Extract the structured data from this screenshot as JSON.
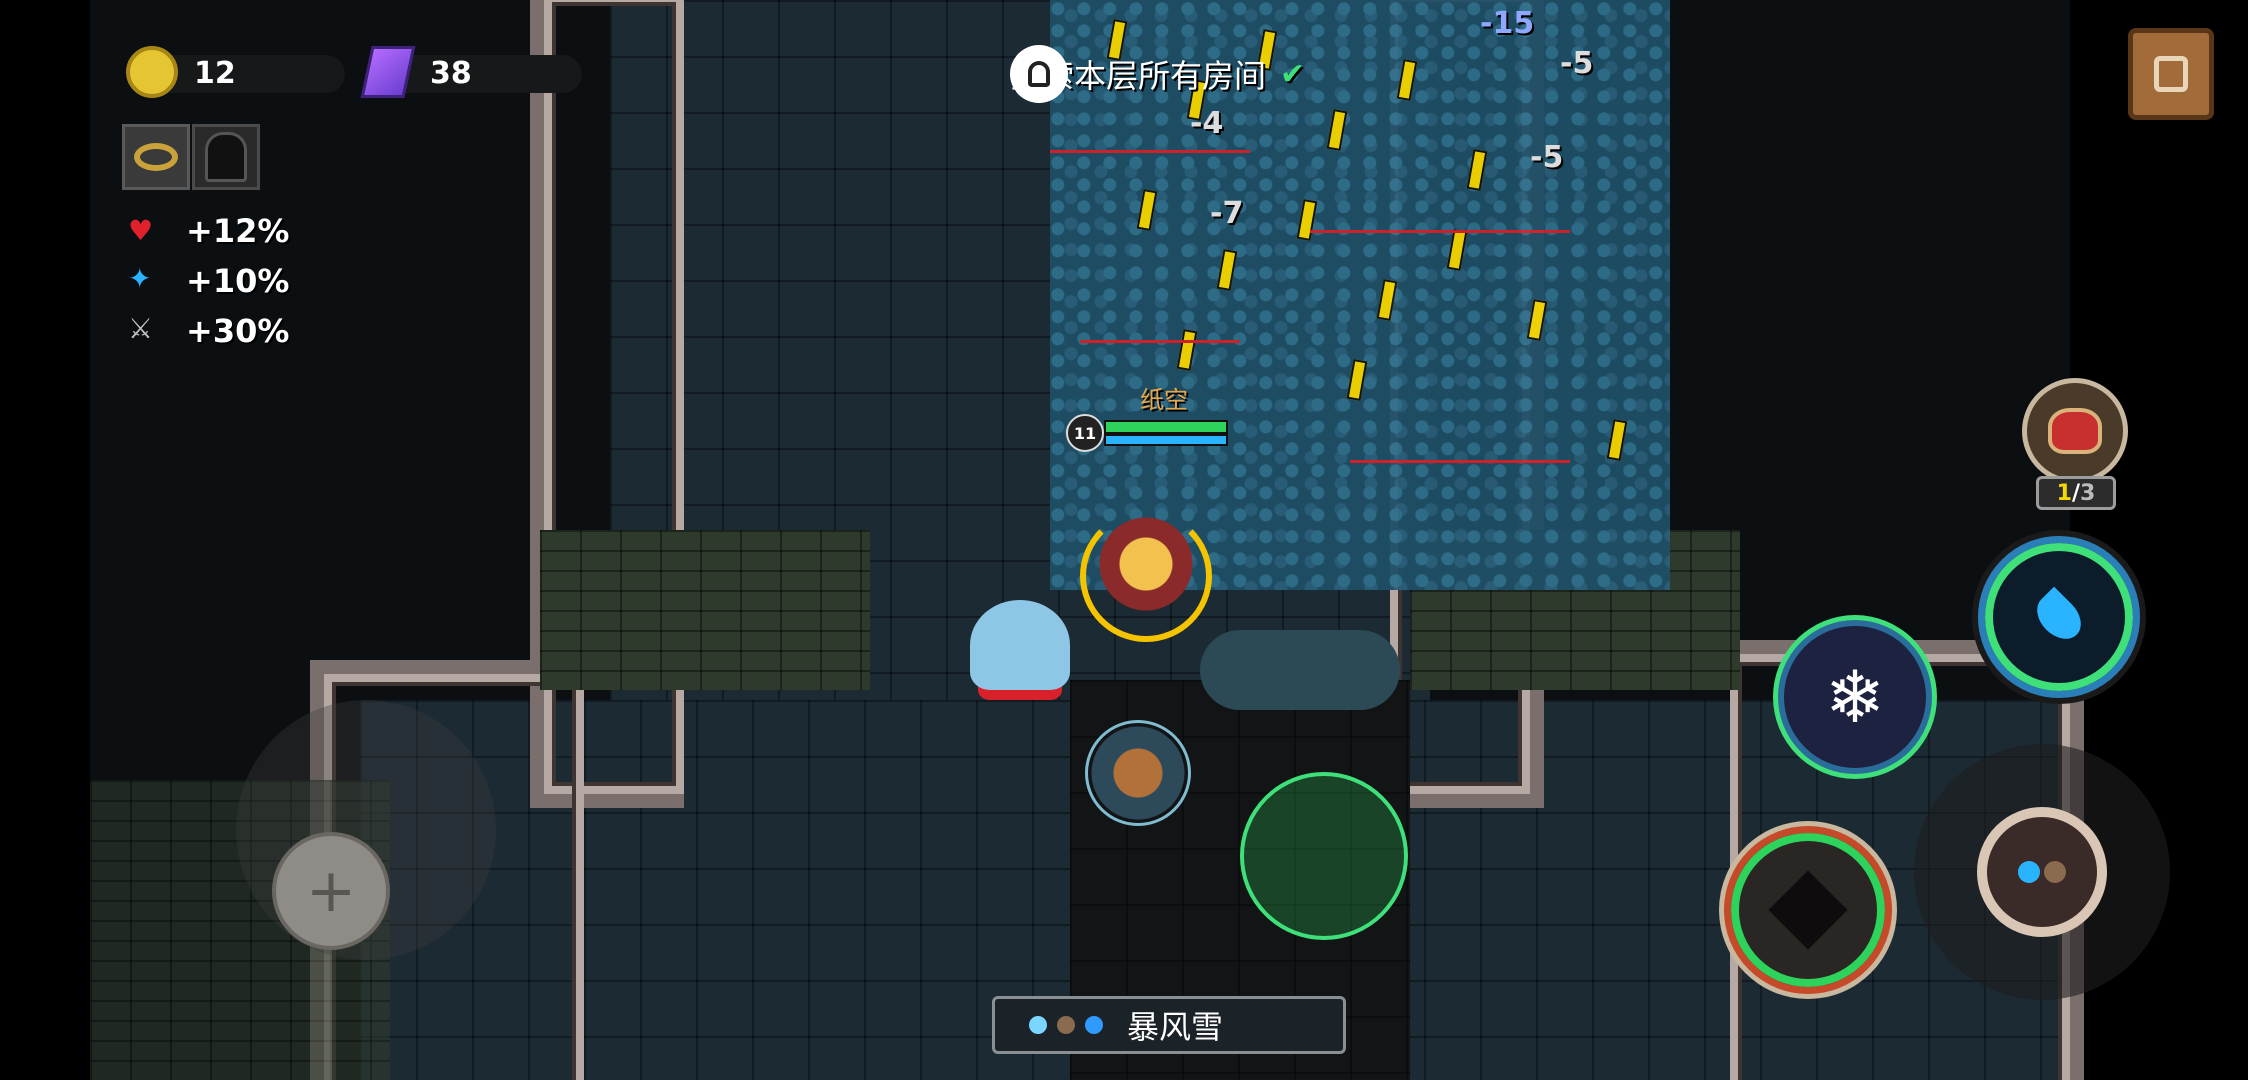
{
  "hud": {
    "gold": {
      "icon": "gold-coin-icon",
      "value": "12"
    },
    "gems": {
      "icon": "purple-gem-icon",
      "value": "38"
    },
    "equipped": [
      "golden-ring-icon",
      "dark-hood-icon"
    ],
    "buffs": [
      {
        "icon": "heart-icon",
        "label": "+12%",
        "color": "#e0202a"
      },
      {
        "icon": "energy-star-icon",
        "label": "+10%",
        "color": "#2ab4ff"
      },
      {
        "icon": "sword-icon",
        "label": "+30%",
        "color": "#c0c0c0"
      }
    ]
  },
  "quest": {
    "text": "探索本层所有房间",
    "icon": "quest-bell-icon",
    "status_icon": "checkmark-icon"
  },
  "damage_numbers": [
    "-15",
    "-5",
    "-4",
    "-5",
    "-7"
  ],
  "player_tag": {
    "name": "纸空",
    "level": "11"
  },
  "consumable": {
    "count_current": "1",
    "count_sep": "/",
    "count_total": "3",
    "icon": "health-pouch-icon"
  },
  "skills": [
    "water-drop-skill-icon",
    "snowflake-skill-icon",
    "dark-crystal-skill-icon",
    "elemental-orb-skill-icon"
  ],
  "weapon": {
    "name": "暴风雪",
    "dot_colors": [
      "#7ad6ff",
      "#8a6b4f",
      "#2f9bff"
    ]
  },
  "controls": {
    "move_icon": "dpad-icon",
    "exit_icon": "exit-door-icon"
  },
  "colors": {
    "accent": "#f5d800",
    "hp_green": "#2ed35c",
    "energy_blue": "#2ab4ff",
    "enemy_red": "#d8212a"
  }
}
